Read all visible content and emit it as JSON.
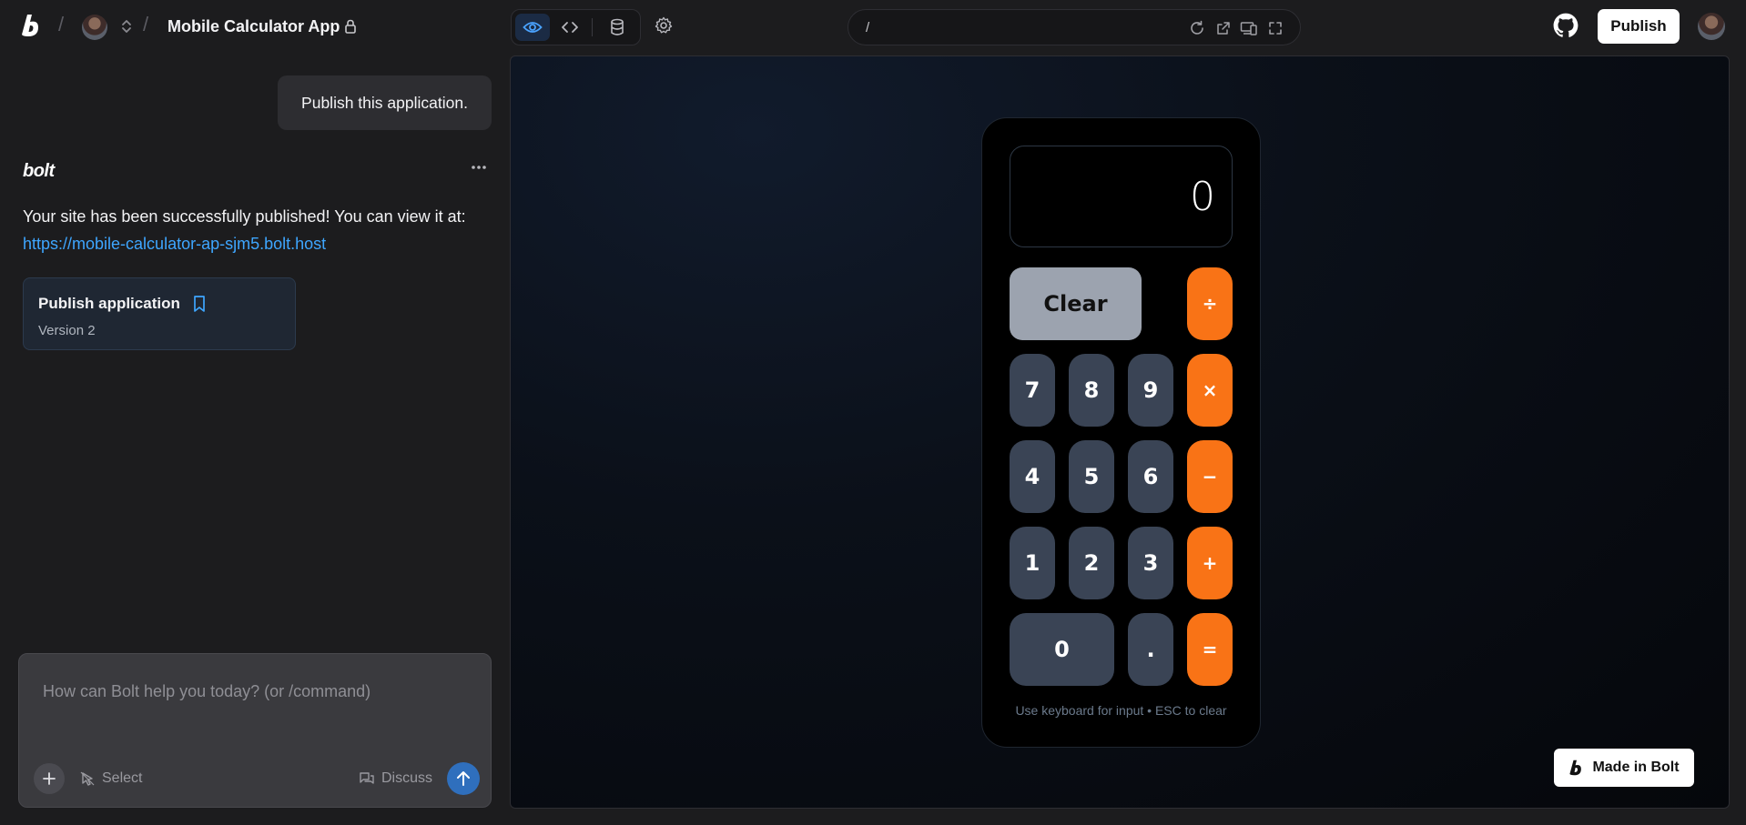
{
  "header": {
    "project_title": "Mobile Calculator App",
    "publish_label": "Publish"
  },
  "urlbar": {
    "path": "/"
  },
  "chat": {
    "user_message": "Publish this application.",
    "assistant_name": "bolt",
    "response_text": "Your site has been successfully published! You can view it at:",
    "response_link": "https://mobile-calculator-ap-sjm5.bolt.host",
    "version_card": {
      "title": "Publish application",
      "subtitle": "Version 2"
    },
    "input_placeholder": "How can Bolt help you today? (or /command)",
    "select_label": "Select",
    "discuss_label": "Discuss"
  },
  "calculator": {
    "display_value": "0",
    "keys": {
      "clear": "Clear",
      "divide": "÷",
      "multiply": "×",
      "subtract": "−",
      "add": "+",
      "equals": "=",
      "seven": "7",
      "eight": "8",
      "nine": "9",
      "four": "4",
      "five": "5",
      "six": "6",
      "one": "1",
      "two": "2",
      "three": "3",
      "zero": "0",
      "decimal": "."
    },
    "hint": "Use keyboard for input • ESC to clear"
  },
  "badge": {
    "label": "Made in Bolt"
  },
  "colors": {
    "accent": "#f97316",
    "link": "#3ea6ff",
    "active_view": "#3b82f6"
  }
}
